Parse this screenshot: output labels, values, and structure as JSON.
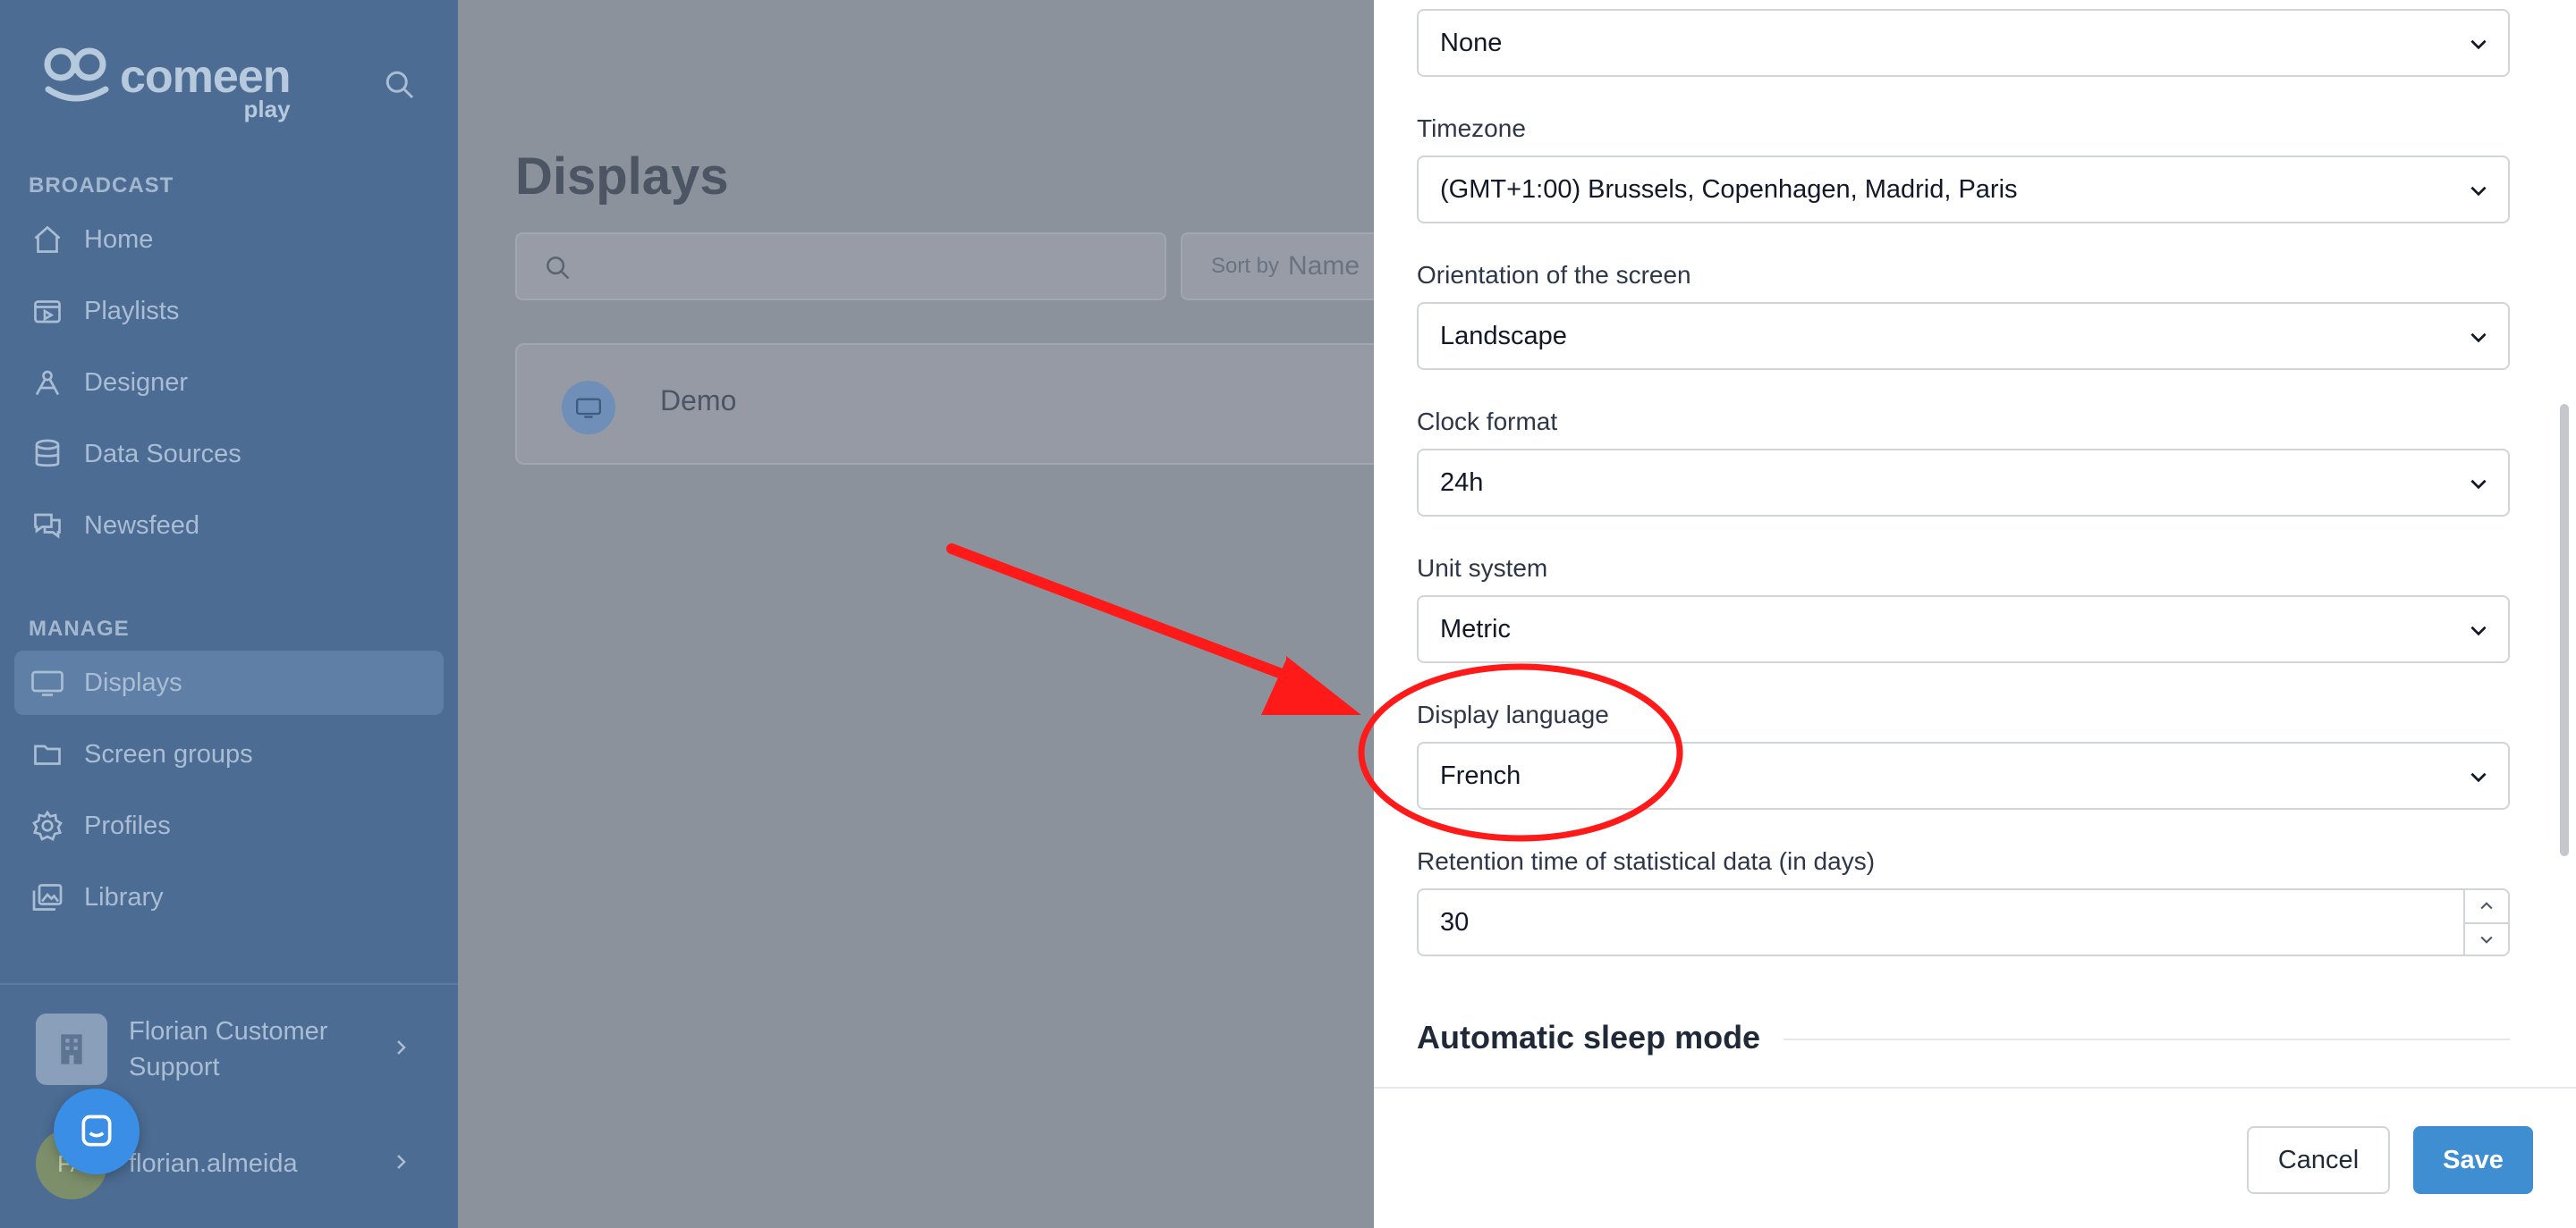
{
  "brand": {
    "name": "comeen",
    "sub": "play"
  },
  "sidebar": {
    "broadcast_label": "BROADCAST",
    "broadcast_items": [
      {
        "label": "Home",
        "icon": "home-icon"
      },
      {
        "label": "Playlists",
        "icon": "playlist-icon"
      },
      {
        "label": "Designer",
        "icon": "designer-icon"
      },
      {
        "label": "Data Sources",
        "icon": "database-icon"
      },
      {
        "label": "Newsfeed",
        "icon": "chat-icon"
      }
    ],
    "manage_label": "MANAGE",
    "manage_items": [
      {
        "label": "Displays",
        "icon": "monitor-icon",
        "active": true
      },
      {
        "label": "Screen groups",
        "icon": "folder-icon"
      },
      {
        "label": "Profiles",
        "icon": "gear-icon"
      },
      {
        "label": "Library",
        "icon": "images-icon"
      }
    ],
    "org_name": "Florian Customer Support",
    "user_name": "florian.almeida",
    "user_initials": "FA"
  },
  "main": {
    "title": "Displays",
    "search_placeholder": "",
    "sort_prefix": "Sort by",
    "sort_value": "Name",
    "displays": [
      {
        "name": "Demo"
      }
    ]
  },
  "panel": {
    "top_select_value": "None",
    "timezone_label": "Timezone",
    "timezone_value": "(GMT+1:00) Brussels, Copenhagen, Madrid, Paris",
    "orientation_label": "Orientation of the screen",
    "orientation_value": "Landscape",
    "clock_label": "Clock format",
    "clock_value": "24h",
    "unit_label": "Unit system",
    "unit_value": "Metric",
    "language_label": "Display language",
    "language_value": "French",
    "retention_label": "Retention time of statistical data (in days)",
    "retention_value": "30",
    "sleep_heading": "Automatic sleep mode",
    "cancel_label": "Cancel",
    "save_label": "Save"
  },
  "colors": {
    "sidebar_bg": "#4c6c93",
    "accent": "#3f8ed1",
    "annotation_red": "#ff1a1a"
  }
}
